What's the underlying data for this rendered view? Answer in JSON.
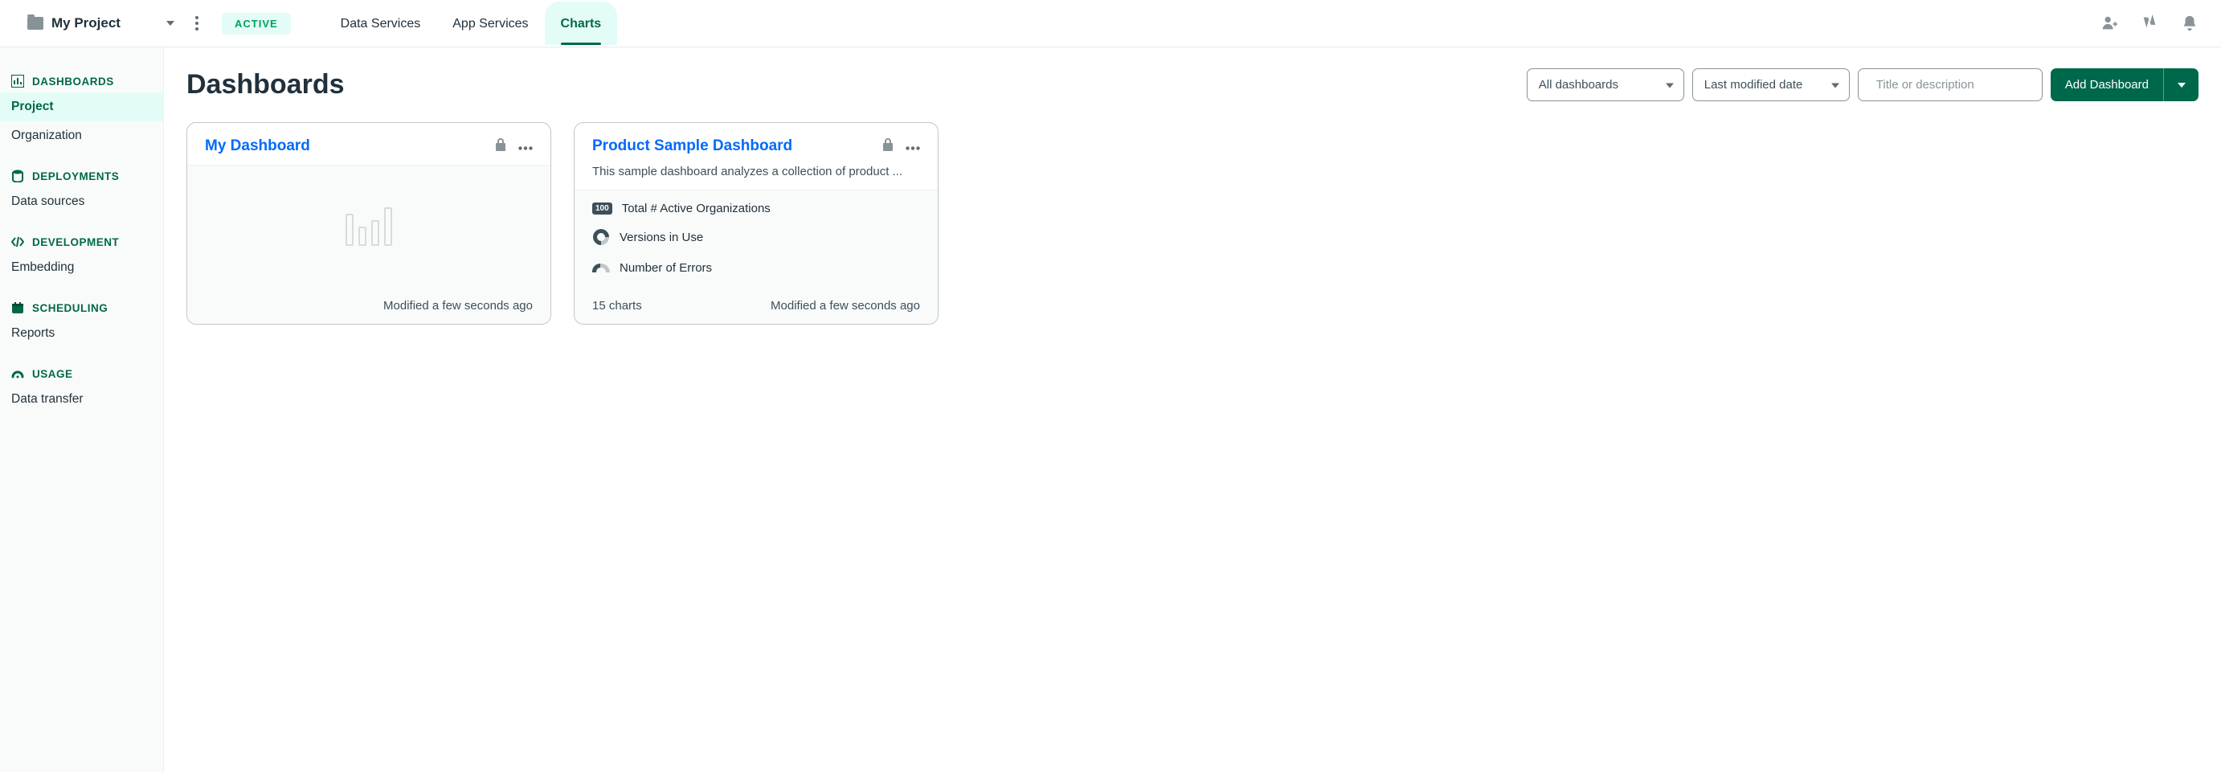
{
  "header": {
    "project_name": "My Project",
    "status": "ACTIVE",
    "tabs": {
      "data_services": "Data Services",
      "app_services": "App Services",
      "charts": "Charts"
    }
  },
  "sidebar": {
    "dashboards": {
      "heading": "DASHBOARDS",
      "project": "Project",
      "organization": "Organization"
    },
    "deployments": {
      "heading": "DEPLOYMENTS",
      "data_sources": "Data sources"
    },
    "development": {
      "heading": "DEVELOPMENT",
      "embedding": "Embedding"
    },
    "scheduling": {
      "heading": "SCHEDULING",
      "reports": "Reports"
    },
    "usage": {
      "heading": "USAGE",
      "data_transfer": "Data transfer"
    }
  },
  "page": {
    "title": "Dashboards",
    "filter_dashboards": "All dashboards",
    "sort_by": "Last modified date",
    "search_placeholder": "Title or description",
    "add_button": "Add Dashboard"
  },
  "cards": {
    "card1": {
      "title": "My Dashboard",
      "modified": "Modified a few seconds ago"
    },
    "card2": {
      "title": "Product Sample Dashboard",
      "description": "This sample dashboard analyzes a collection of product ...",
      "metrics": {
        "m1_badge": "100",
        "m1_label": "Total # Active Organizations",
        "m2_label": "Versions in Use",
        "m3_label": "Number of  Errors"
      },
      "count": "15 charts",
      "modified": "Modified a few seconds ago"
    }
  }
}
